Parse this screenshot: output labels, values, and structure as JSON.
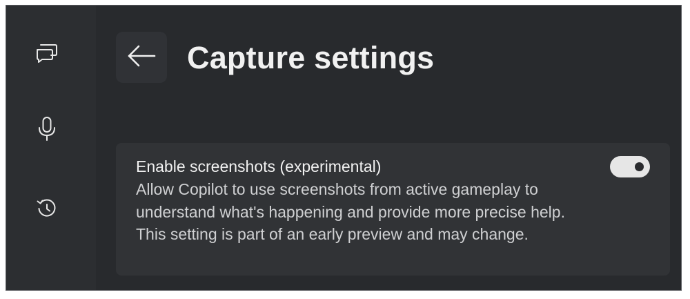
{
  "sidebar": {
    "items": [
      {
        "icon": "chat-bubbles-icon"
      },
      {
        "icon": "microphone-icon"
      },
      {
        "icon": "history-icon"
      }
    ]
  },
  "header": {
    "back_icon": "back-arrow-icon",
    "title": "Capture settings"
  },
  "setting": {
    "title": "Enable screenshots (experimental)",
    "description": "Allow Copilot to use screenshots from active gameplay to understand what's happening and provide more precise help. This setting is part of an early preview and may change.",
    "enabled": true
  },
  "colors": {
    "background": "#282a2d",
    "sidebar": "#2c2e31",
    "card": "#313336",
    "text": "#f1f1f1",
    "toggle_on": "#e6e6e6"
  }
}
